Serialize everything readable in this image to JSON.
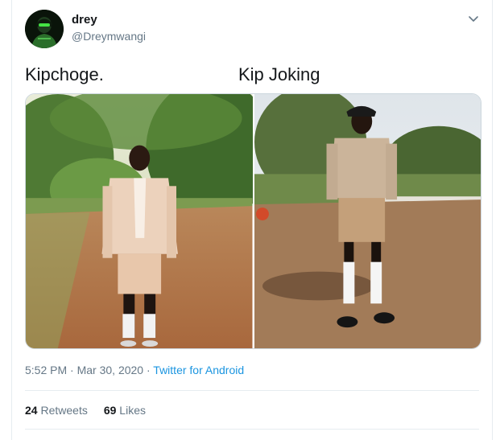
{
  "user": {
    "name": "drey",
    "handle": "@Dreymwangi"
  },
  "captions": {
    "left": "Kipchoge.",
    "right": "Kip Joking"
  },
  "meta": {
    "time": "5:52 PM",
    "separator": "·",
    "date": "Mar 30, 2020",
    "source": "Twitter for Android"
  },
  "stats": {
    "retweets_count": "24",
    "retweets_label": "Retweets",
    "likes_count": "69",
    "likes_label": "Likes"
  },
  "colors": {
    "link": "#1b95e0",
    "muted": "#657786",
    "text": "#14171a"
  },
  "icons": {
    "menu": "chevron-down-icon"
  }
}
